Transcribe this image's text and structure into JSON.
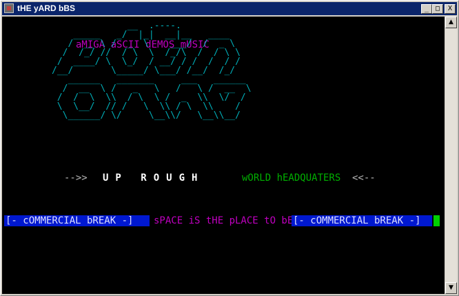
{
  "window": {
    "title": "tHE yARD bBS",
    "minimize": "_",
    "maximize": "□",
    "close": "X"
  },
  "screen": {
    "tagline": "aMIGA aSCII dEMOS mUSIC",
    "art_logo": "              __  .----.   \n    _____   _/  |_|  __|__   ____\n   /  __ \\ /  _  \\    ___/  /  _ \\\n  /  /_/ //  / \\  \\  /_/\\  /  / \\ \\\n /  ____/ \\  \\_/  / __/ / /  /  / /\n/__/       \\_____/ \\___/ /__/  /_/\n   ______   _______     ___   ______\n  /  __  \\ /   _   \\   /   \\ /  __  \\\n /  /  \\  \\\\  / \\  \\ /  _  \\\\  \\/  /\n \\  \\__/  // /   \\  \\\\ / \\  \\\\    /\n  \\______/ \\/     \\__\\\\/   \\__\\\\__/",
    "left_arrow": "-->>",
    "up_rough": "UP ROUGH",
    "world_hq": "wORLD hEADQUATERS",
    "right_arrow": "<<--",
    "commercial_break_left": "[- cOMMERCIAL bREAK -]",
    "space_text": "sPACE iS tHE pLACE tO bE",
    "commercial_break_right": "[- cOMMERCIAL bREAK -]"
  },
  "scrollbar": {
    "up_arrow": "▲",
    "down_arrow": "▼"
  }
}
